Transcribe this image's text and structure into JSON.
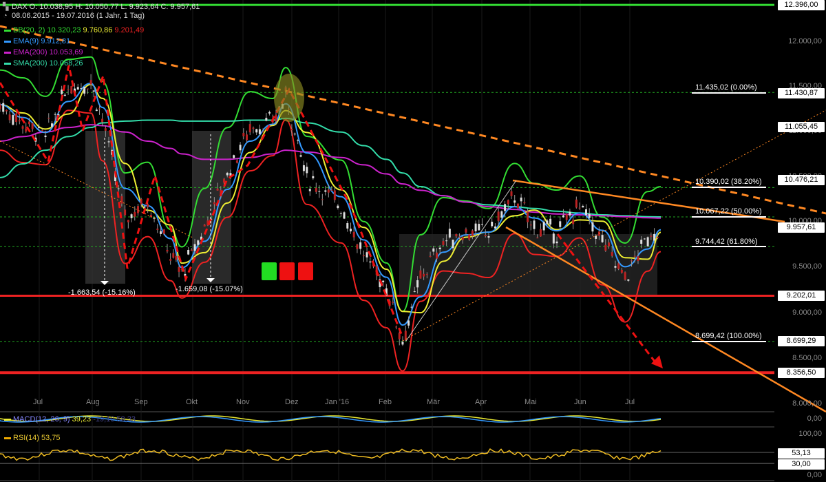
{
  "header": {
    "line1": "DAX  O: 10.038,95  H: 10.050,77  L: 9.923,64  C: 9.957,61",
    "line2": "08.06.2015 - 19.07.2016 (1 Jahr, 1 Tag)"
  },
  "legend": [
    {
      "name": "BB(20, 2)",
      "values": [
        "10.320,23",
        "9.760,86",
        "9.201,49"
      ],
      "colors": [
        "#33dd33",
        "#eeee33",
        "#ee2222"
      ]
    },
    {
      "name": "EMA(9)",
      "values": [
        "9.912,81"
      ],
      "colors": [
        "#3399ff"
      ]
    },
    {
      "name": "EMA(200)",
      "values": [
        "10.053,69"
      ],
      "colors": [
        "#cc22cc"
      ]
    },
    {
      "name": "SMA(200)",
      "values": [
        "10.068,26"
      ],
      "colors": [
        "#33ddaa"
      ]
    }
  ],
  "price_labels": [
    "12.396,00",
    "11.430,87",
    "11.055,45",
    "10.476,21",
    "9.957,61",
    "9.202,01",
    "8.699,29",
    "8.356,50"
  ],
  "y_ticks": [
    "12.000,00",
    "11.500,00",
    "11.000,00",
    "10.500,00",
    "10.000,00",
    "9.500,00",
    "9.000,00",
    "8.500,00",
    "8.000,00"
  ],
  "fib_levels": [
    "11.435,02 (0.00%)",
    "10.390,02 (38.20%)",
    "10.067,22 (50.00%)",
    "9.744,42 (61.80%)",
    "8.699,42 (100.00%)"
  ],
  "months": [
    "Jul",
    "Aug",
    "Sep",
    "Okt",
    "Nov",
    "Dez",
    "Jan '16",
    "Feb",
    "Mär",
    "Apr",
    "Mai",
    "Jun",
    "Jul"
  ],
  "annotations": [
    "-1.663,54 (-15.16%)",
    "-1.659,08 (-15.07%)"
  ],
  "macd": {
    "label": "MACD(12, 26, 9)",
    "value": "39,23",
    "hidden": "-19,10  58,33",
    "ticks": [
      "0,00"
    ]
  },
  "rsi": {
    "label": "RSI(14)",
    "value": "53,75",
    "ticks": [
      "100,00",
      "53,13",
      "30,00",
      "0,00"
    ]
  },
  "colors": {
    "bb_upper": "#33dd33",
    "bb_mid": "#eeee33",
    "bb_lower": "#ee2222",
    "ema9": "#3399ff",
    "ema200": "#cc22cc",
    "sma200": "#33ddaa",
    "trend": "#ff8822",
    "support": "#ee2222"
  },
  "chart_data": {
    "type": "line",
    "title": "DAX",
    "ylim": [
      7900,
      12450
    ],
    "x": [
      "2015-06-08",
      "2015-06-22",
      "2015-07-06",
      "2015-07-20",
      "2015-08-03",
      "2015-08-10",
      "2015-08-24",
      "2015-09-07",
      "2015-09-21",
      "2015-09-28",
      "2015-10-12",
      "2015-10-26",
      "2015-11-09",
      "2015-11-23",
      "2015-12-01",
      "2015-12-14",
      "2016-01-04",
      "2016-01-18",
      "2016-02-01",
      "2016-02-11",
      "2016-02-22",
      "2016-03-07",
      "2016-03-21",
      "2016-04-04",
      "2016-04-20",
      "2016-05-02",
      "2016-05-16",
      "2016-05-30",
      "2016-06-13",
      "2016-06-27",
      "2016-07-11",
      "2016-07-19"
    ],
    "series": [
      {
        "name": "DAX",
        "values": [
          11300,
          11100,
          10950,
          11500,
          11550,
          11150,
          10050,
          10250,
          9650,
          9450,
          9950,
          10550,
          11050,
          11100,
          11400,
          10500,
          10200,
          9650,
          9300,
          8700,
          9400,
          9800,
          9900,
          9900,
          10300,
          9950,
          9900,
          10200,
          9800,
          9400,
          9850,
          9958
        ]
      },
      {
        "name": "EMA(200)",
        "values": [
          10900,
          10950,
          11000,
          11050,
          11080,
          11070,
          11000,
          10900,
          10820,
          10760,
          10700,
          10700,
          10720,
          10760,
          10800,
          10780,
          10720,
          10640,
          10540,
          10430,
          10360,
          10300,
          10230,
          10180,
          10150,
          10120,
          10100,
          10090,
          10080,
          10070,
          10058,
          10054
        ]
      },
      {
        "name": "SMA(200)",
        "values": [
          10500,
          10650,
          10800,
          10950,
          11050,
          11100,
          11120,
          11130,
          11130,
          11120,
          11120,
          11120,
          11130,
          11130,
          11150,
          11100,
          11000,
          10850,
          10700,
          10550,
          10400,
          10300,
          10230,
          10200,
          10180,
          10160,
          10130,
          10110,
          10090,
          10080,
          10070,
          10068
        ]
      }
    ],
    "hlines": [
      12396.0,
      9202.01,
      8356.5
    ],
    "fib": [
      11435.02,
      10390.02,
      10067.22,
      9744.42,
      8699.42
    ]
  },
  "icon": "chart-icon"
}
